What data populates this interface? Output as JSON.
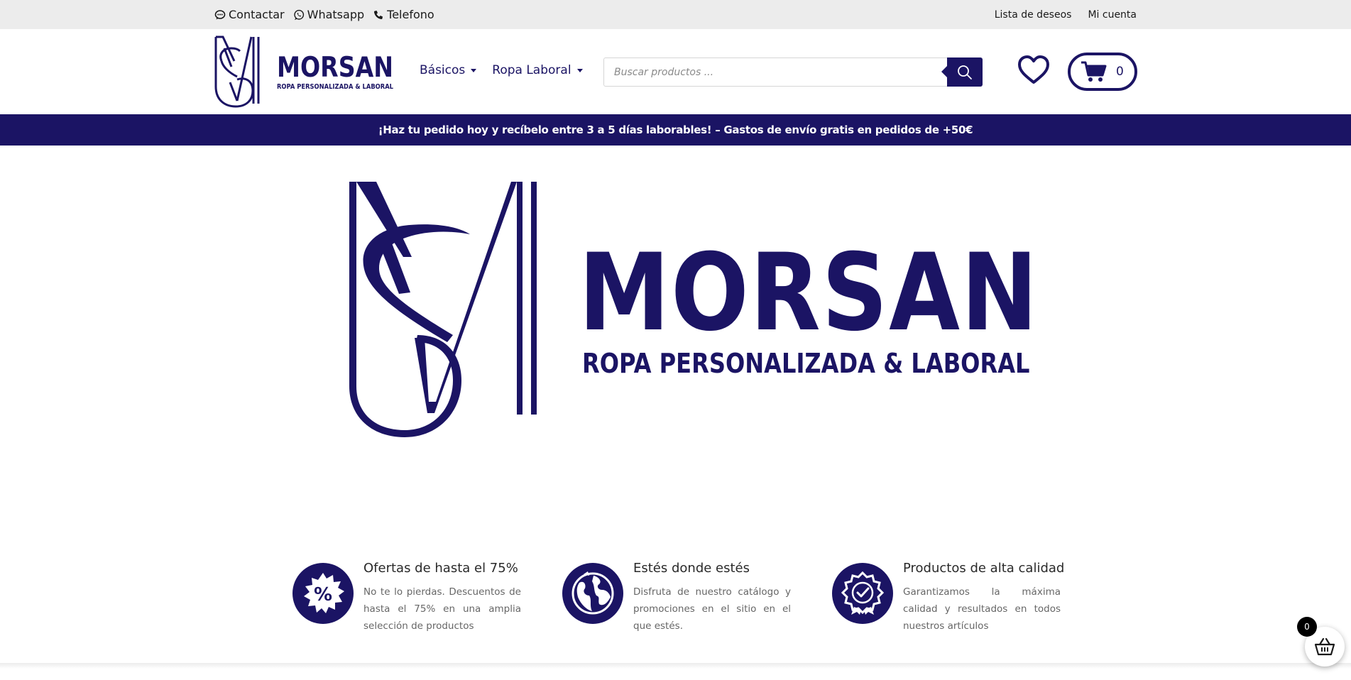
{
  "topbar": {
    "links": [
      {
        "label": "Contactar",
        "icon": "chat-bubble-icon"
      },
      {
        "label": "Whatsapp",
        "icon": "whatsapp-icon"
      },
      {
        "label": "Telefono",
        "icon": "phone-icon"
      }
    ],
    "right": {
      "wishlist": "Lista de deseos",
      "account": "Mi cuenta"
    }
  },
  "header": {
    "logo": {
      "name": "MORSAN",
      "tagline": "ROPA PERSONALIZADA & LABORAL"
    },
    "nav": [
      {
        "label": "Básicos"
      },
      {
        "label": "Ropa Laboral"
      }
    ],
    "search": {
      "placeholder": "Buscar productos ..."
    },
    "cart_count": "0"
  },
  "promo": {
    "text": "¡Haz tu pedido hoy y recíbelo entre 3 a 5 días laborables! – Gastos de envío gratis en pedidos de +50€"
  },
  "hero": {
    "title": "MORSAN",
    "subtitle": "ROPA PERSONALIZADA & LABORAL"
  },
  "features": [
    {
      "title": "Ofertas de hasta el 75%",
      "text": "No te lo pierdas. Descuentos de hasta el 75% en una amplia selección de productos",
      "icon": "percent-badge-icon"
    },
    {
      "title": "Estés donde estés",
      "text": "Disfruta de nuestro catálogo y promociones en el sitio en el que estés.",
      "icon": "globe-icon"
    },
    {
      "title": "Productos de alta calidad",
      "text": "Garantizamos la máxima calidad y resultados en todos nuestros artículos",
      "icon": "quality-seal-icon"
    }
  ],
  "floating_cart": {
    "count": "0"
  },
  "colors": {
    "brand": "#1b1464",
    "topbar_bg": "#ececec",
    "white": "#ffffff"
  }
}
